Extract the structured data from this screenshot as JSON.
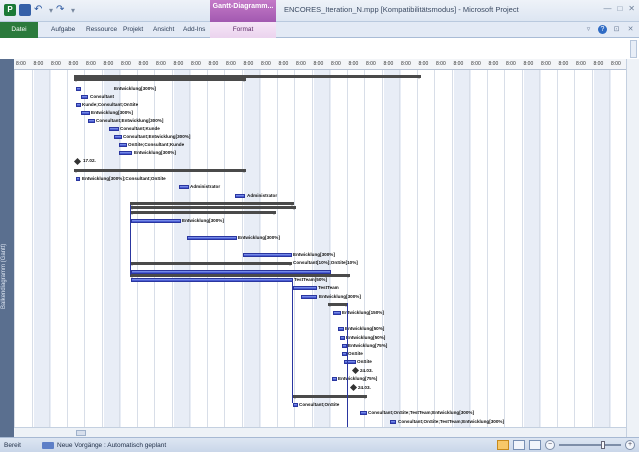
{
  "window": {
    "title": "ENCORES_Iteration_N.mpp [Kompatibilitätsmodus] - Microsoft Project",
    "context_tab": "Gantt-Diagramm...",
    "controls": [
      "—",
      "□",
      "✕"
    ]
  },
  "ribbon": {
    "tabs": [
      "Datei",
      "Aufgabe",
      "Ressource",
      "Projekt",
      "Ansicht",
      "Add-Ins",
      "Format"
    ]
  },
  "sidebar": {
    "label": "Balkendiagramm (Gantt)"
  },
  "timescale": {
    "tick_label": "8:00"
  },
  "tasks": [
    "Entwicklung[300%]",
    "Consultant",
    "Kunde;Consultant;OnSite",
    "Entwicklung[300%]",
    "Consultant;Entwicklung[300%]",
    "Consultant;Kunde",
    "Consultant;Entwicklung[300%]",
    "OnSite;Consultant;Kunde",
    "Entwicklung[300%]",
    "17.02.",
    "Entwicklung[300%];Consultant;OnSite",
    "Administrator",
    "Administrator",
    "Entwicklung[300%]",
    "Entwicklung[300%]",
    "Entwicklung[300%]",
    "Consultant[10%];OnSite[10%]",
    "TestTeam[50%]",
    "TestTeam",
    "Entwicklung[300%]",
    "Entwicklung[150%]",
    "Entwicklung[50%]",
    "Entwicklung[50%]",
    "Entwicklung[75%]",
    "OnSite",
    "OnSite",
    "24.03.",
    "Entwicklung[75%]",
    "24.03.",
    "Consultant;OnSite",
    "Consultant;OnSite;TestTeam;Entwicklung[300%]",
    "Consultant;OnSite;TestTeam;Entwicklung[300%]",
    "Consultant;OnSite;Entwicklung[300%]"
  ],
  "status": {
    "ready": "Bereit",
    "mode": "Neue Vorgänge : Automatisch geplant",
    "zoom_fraction": 0.72
  },
  "colors": {
    "file_tab": "#2b7a3c",
    "task_bar": "#3748c9",
    "context_tab": "#a259b0"
  }
}
